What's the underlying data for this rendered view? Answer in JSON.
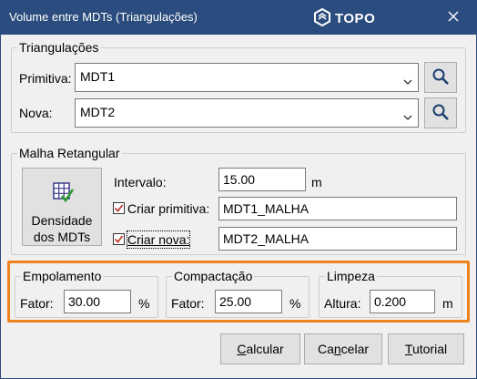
{
  "window": {
    "title": "Volume entre MDTs (Triangulações)",
    "brand": "TOPO"
  },
  "triangulacoes": {
    "title": "Triangulações",
    "primitiva_label": "Primitiva:",
    "primitiva_value": "MDT1",
    "nova_label": "Nova:",
    "nova_value": "MDT2"
  },
  "malha": {
    "title": "Malha Retangular",
    "density_button": [
      "Densidade",
      "dos MDTs"
    ],
    "intervalo_label": "Intervalo:",
    "intervalo_value": "15.00",
    "intervalo_unit": "m",
    "criar_primitiva_label": "Criar primitiva:",
    "criar_primitiva_checked": true,
    "criar_primitiva_value": "MDT1_MALHA",
    "criar_nova_label": "Criar nova:",
    "criar_nova_checked": true,
    "criar_nova_value": "MDT2_MALHA"
  },
  "empolamento": {
    "title": "Empolamento",
    "label": "Fator:",
    "value": "30.00",
    "unit": "%"
  },
  "compactacao": {
    "title": "Compactação",
    "label": "Fator:",
    "value": "25.00",
    "unit": "%"
  },
  "limpeza": {
    "title": "Limpeza",
    "label": "Altura:",
    "value": "0.200",
    "unit": "m"
  },
  "buttons": {
    "calcular": {
      "mnemonic": "C",
      "rest": "alcular"
    },
    "cancelar": {
      "pre": "Ca",
      "mnemonic": "n",
      "rest": "celar"
    },
    "tutorial": {
      "mnemonic": "T",
      "rest": "utorial"
    }
  },
  "colors": {
    "titlebar": "#2b4c7e",
    "highlight": "#f0821e"
  }
}
